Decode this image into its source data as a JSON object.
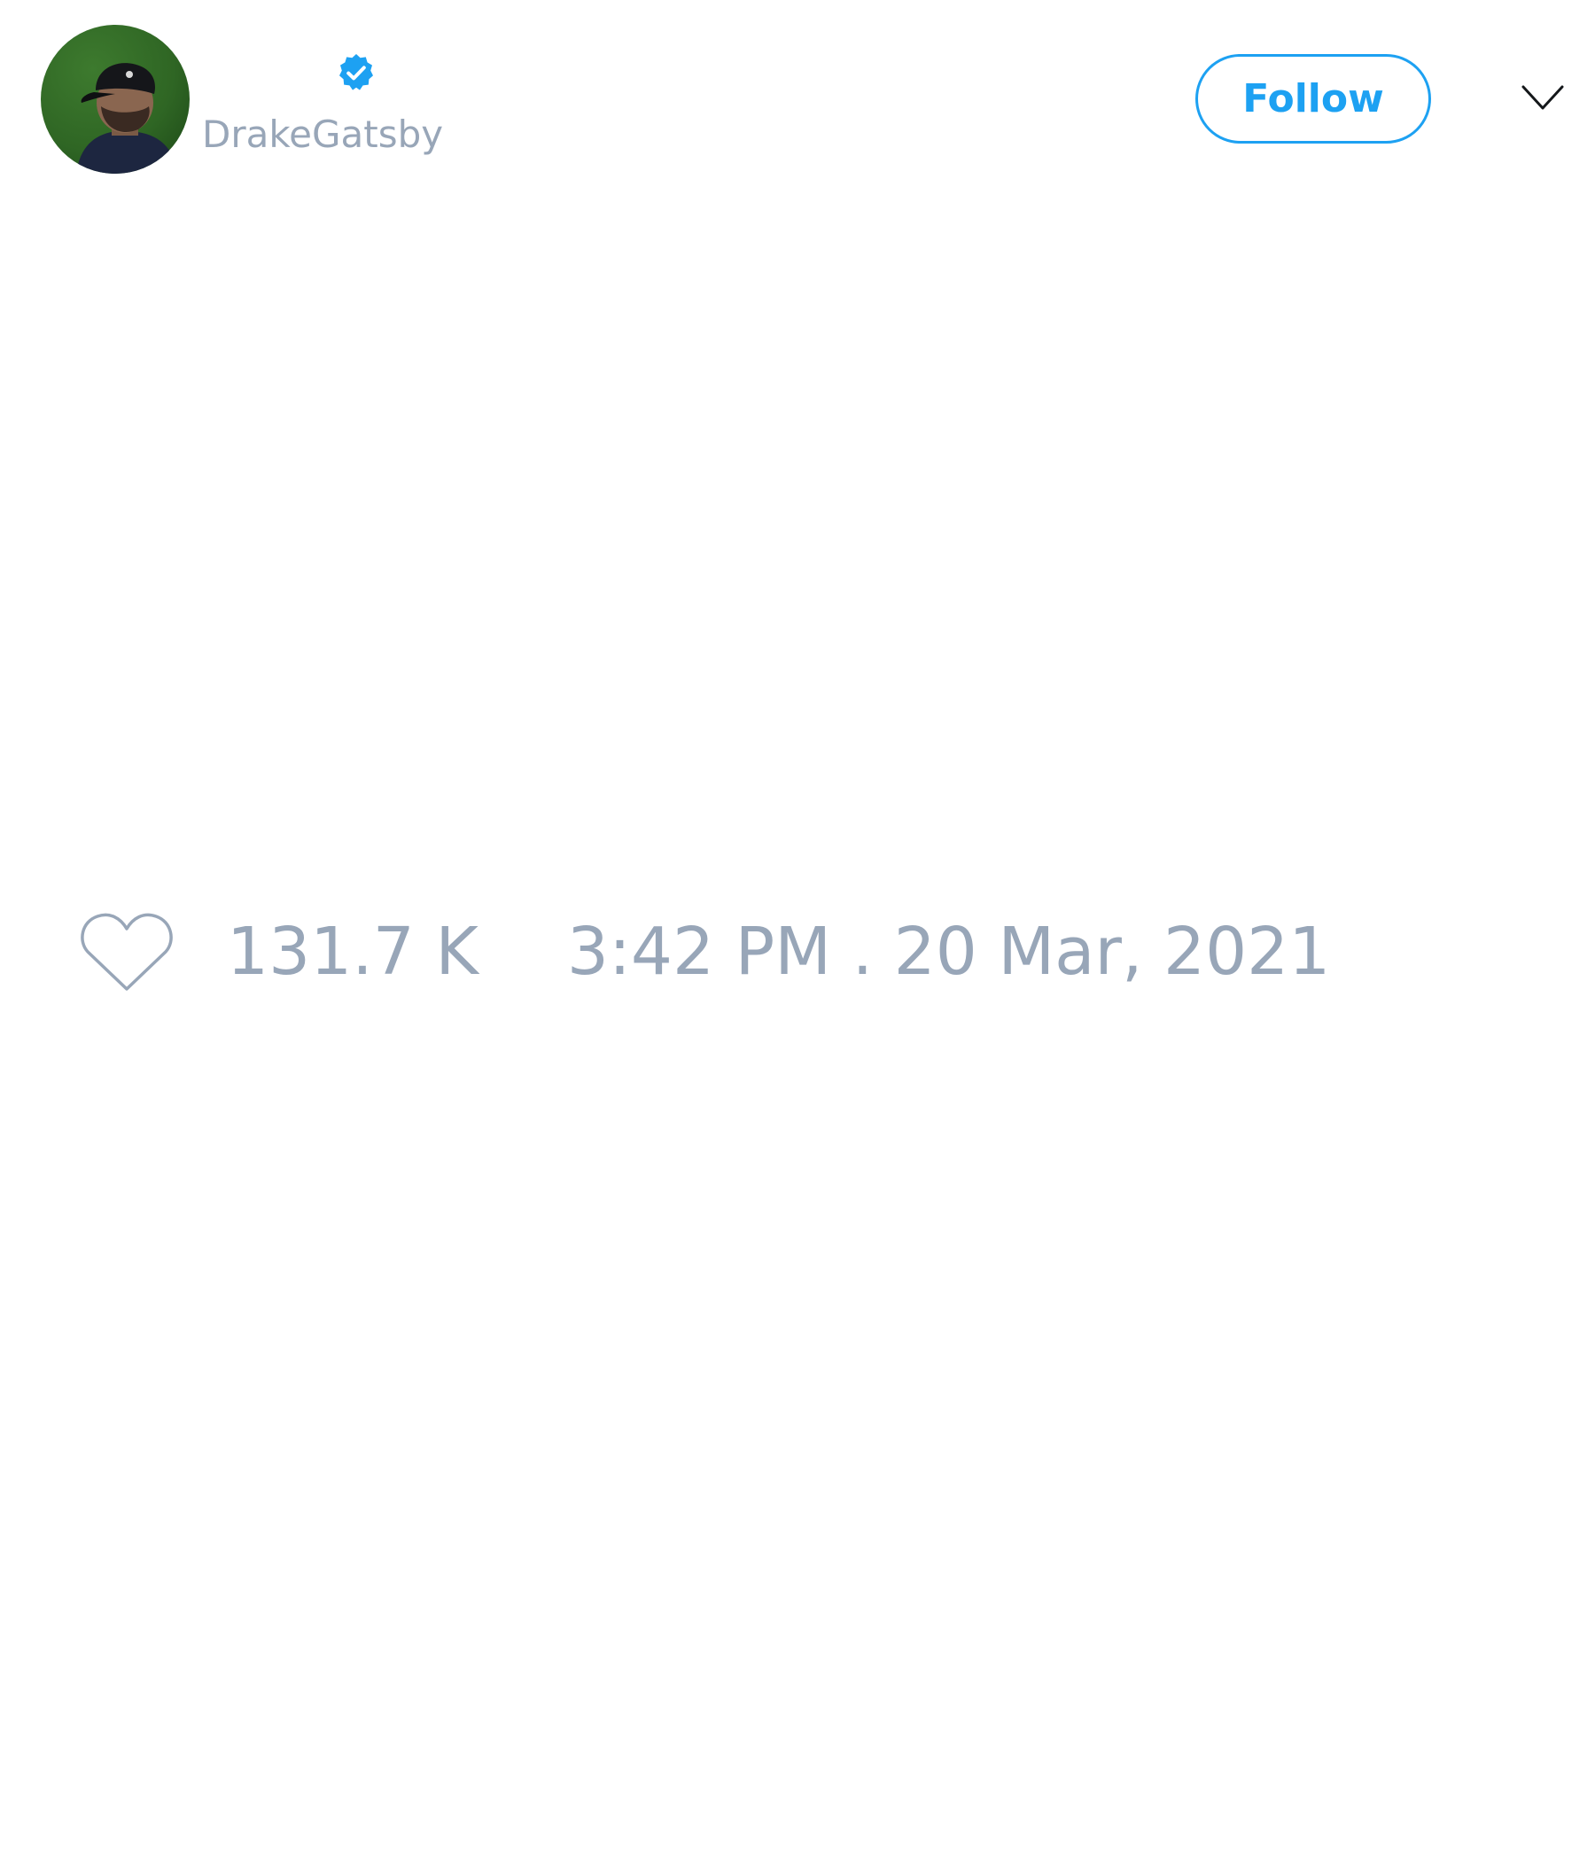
{
  "author": {
    "handle": "DrakeGatsby",
    "verified": true,
    "avatar_icon": "profile-photo"
  },
  "header": {
    "follow_label": "Follow",
    "more_icon": "chevron-down-icon"
  },
  "stats": {
    "like_icon": "heart-outline-icon",
    "likes": "131.7 K",
    "timestamp": "3:42 PM . 20 Mar, 2021"
  },
  "colors": {
    "accent": "#1da1f2",
    "muted_text": "#98a6b8",
    "background": "#ffffff"
  }
}
